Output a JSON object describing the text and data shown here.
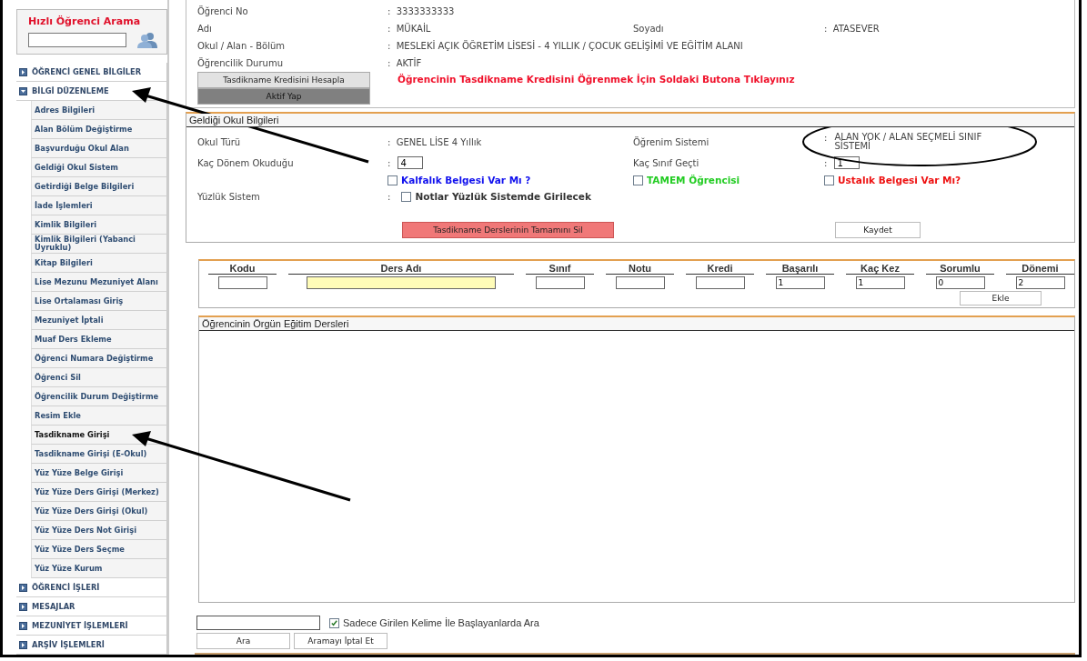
{
  "quick_search": {
    "title": "Hızlı Öğrenci Arama"
  },
  "menu": [
    {
      "label": "ÖĞRENCİ GENEL BİLGİLER",
      "expanded": false
    },
    {
      "label": "BİLGİ DÜZENLEME",
      "expanded": true,
      "children": [
        {
          "label": "Adres Bilgileri",
          "selected": false
        },
        {
          "label": "Alan Bölüm Değiştirme",
          "selected": false
        },
        {
          "label": "Başvurduğu Okul Alan",
          "selected": false
        },
        {
          "label": "Geldiği Okul Sistem",
          "selected": false
        },
        {
          "label": "Getirdiği Belge Bilgileri",
          "selected": false
        },
        {
          "label": "İade İşlemleri",
          "selected": false
        },
        {
          "label": "Kimlik Bilgileri",
          "selected": false
        },
        {
          "label": "Kimlik Bilgileri (Yabanci Uyruklu)",
          "selected": false
        },
        {
          "label": "Kitap Bilgileri",
          "selected": false
        },
        {
          "label": "Lise Mezunu Mezuniyet Alanı",
          "selected": false
        },
        {
          "label": "Lise Ortalaması Giriş",
          "selected": false
        },
        {
          "label": "Mezuniyet İptali",
          "selected": false
        },
        {
          "label": "Muaf Ders Ekleme",
          "selected": false
        },
        {
          "label": "Öğrenci Numara Değiştirme",
          "selected": false
        },
        {
          "label": "Öğrenci Sil",
          "selected": false
        },
        {
          "label": "Öğrencilik Durum Değiştirme",
          "selected": false
        },
        {
          "label": "Resim Ekle",
          "selected": false
        },
        {
          "label": "Tasdikname Girişi",
          "selected": true
        },
        {
          "label": "Tasdikname Girişi (E-Okul)",
          "selected": false
        },
        {
          "label": "Yüz Yüze Belge Girişi",
          "selected": false
        },
        {
          "label": "Yüz Yüze Ders Girişi (Merkez)",
          "selected": false
        },
        {
          "label": "Yüz Yüze Ders Girişi (Okul)",
          "selected": false
        },
        {
          "label": "Yüz Yüze Ders Not Girişi",
          "selected": false
        },
        {
          "label": "Yüz Yüze Ders Seçme",
          "selected": false
        },
        {
          "label": "Yüz Yüze Kurum",
          "selected": false
        }
      ]
    },
    {
      "label": "ÖĞRENCİ İŞLERİ",
      "expanded": false
    },
    {
      "label": "MESAJLAR",
      "expanded": false
    },
    {
      "label": "MEZUNİYET İŞLEMLERİ",
      "expanded": false
    },
    {
      "label": "ARŞİV İŞLEMLERİ",
      "expanded": false
    }
  ],
  "student": {
    "rows": [
      [
        {
          "label": "Öğrenci No",
          "sep": ":",
          "value": "3333333333"
        }
      ],
      [
        {
          "label": "Adı",
          "sep": ":",
          "value": "MÜKAİL"
        },
        {
          "label": "Soyadı",
          "sep": ":",
          "value": "ATASEVER"
        }
      ],
      [
        {
          "label": "Okul / Alan - Bölüm",
          "sep": ":",
          "value": "MESLEKİ AÇIK ÖĞRETİM LİSESİ - 4 YILLIK / ÇOCUK GELİŞİMİ VE EĞİTİM ALANI"
        }
      ],
      [
        {
          "label": "Öğrencilik Durumu",
          "sep": ":",
          "value": "AKTİF"
        }
      ]
    ],
    "calc_button": "Tasdikname Kredisini Hesapla",
    "activate_button": "Aktif Yap",
    "notice": "Öğrencinin Tasdikname Kredisini Öğrenmek İçin Soldaki Butona Tıklayınız"
  },
  "previous_school": {
    "title": "Geldiği Okul Bilgileri",
    "school_type": {
      "label": "Okul Türü",
      "sep": ":",
      "value": "GENEL LİSE 4 Yıllık"
    },
    "learning_system": {
      "label": "Öğrenim Sistemi",
      "sep": ":",
      "value": "ALAN YOK / ALAN SEÇMELİ SINIF SİSTEMİ"
    },
    "terms": {
      "label": "Kaç Dönem Okuduğu",
      "sep": ":",
      "value": "4"
    },
    "grades_passed": {
      "label": "Kaç Sınıf Geçti",
      "sep": ":",
      "value": "1"
    },
    "checkboxes": [
      {
        "label": "Kalfalık Belgesi Var Mı ?",
        "checked": false,
        "color": "#1010ee"
      },
      {
        "label": "TAMEM Öğrencisi",
        "checked": false,
        "color": "#22cc22"
      },
      {
        "label": "Ustalık Belgesi Var Mı?",
        "checked": false,
        "color": "#ee1111"
      }
    ],
    "hundred_system": {
      "label": "Yüzlük Sistem",
      "sep": ":",
      "checkbox_label": "Notlar Yüzlük Sistemde Girilecek",
      "checked": false
    },
    "delete_button": "Tasdikname Derslerinin Tamamını  Sil",
    "save_button": "Kaydet"
  },
  "course_entry": {
    "columns": [
      {
        "label": "Kodu",
        "kind": "small"
      },
      {
        "label": "Ders Adı",
        "kind": "wide"
      },
      {
        "label": "Sınıf",
        "kind": "small"
      },
      {
        "label": "Notu",
        "kind": "small"
      },
      {
        "label": "Kredi",
        "kind": "small"
      },
      {
        "label": "Başarılı",
        "value": "1",
        "kind": "small"
      },
      {
        "label": "Kaç Kez",
        "value": "1",
        "kind": "small"
      },
      {
        "label": "Sorumlu",
        "value": "0",
        "kind": "small"
      },
      {
        "label": "Dönemi",
        "value": "2",
        "kind": "small"
      }
    ],
    "add_button": "Ekle"
  },
  "courses_panel": {
    "title": "Öğrencinin Örgün Eğitim Dersleri"
  },
  "search": {
    "checkbox_label": "Sadece Girilen Kelime İle Başlayanlarda Ara",
    "checked": true,
    "search_button": "Ara",
    "cancel_button": "Aramayı İptal Et"
  }
}
